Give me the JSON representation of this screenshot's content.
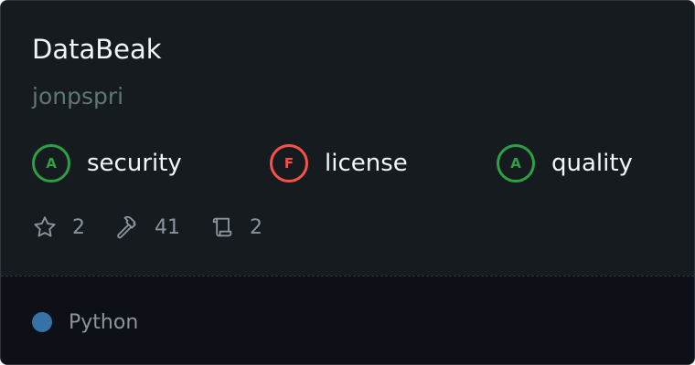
{
  "repo": {
    "name": "DataBeak",
    "owner": "jonpspri"
  },
  "grades": [
    {
      "grade": "A",
      "label": "security",
      "status_color": "#2ea043"
    },
    {
      "grade": "F",
      "label": "license",
      "status_color": "#f85149"
    },
    {
      "grade": "A",
      "label": "quality",
      "status_color": "#2ea043"
    }
  ],
  "stats": {
    "stars": "2",
    "tools": "41",
    "releases": "2"
  },
  "language": {
    "name": "Python",
    "color": "#3572a5"
  }
}
